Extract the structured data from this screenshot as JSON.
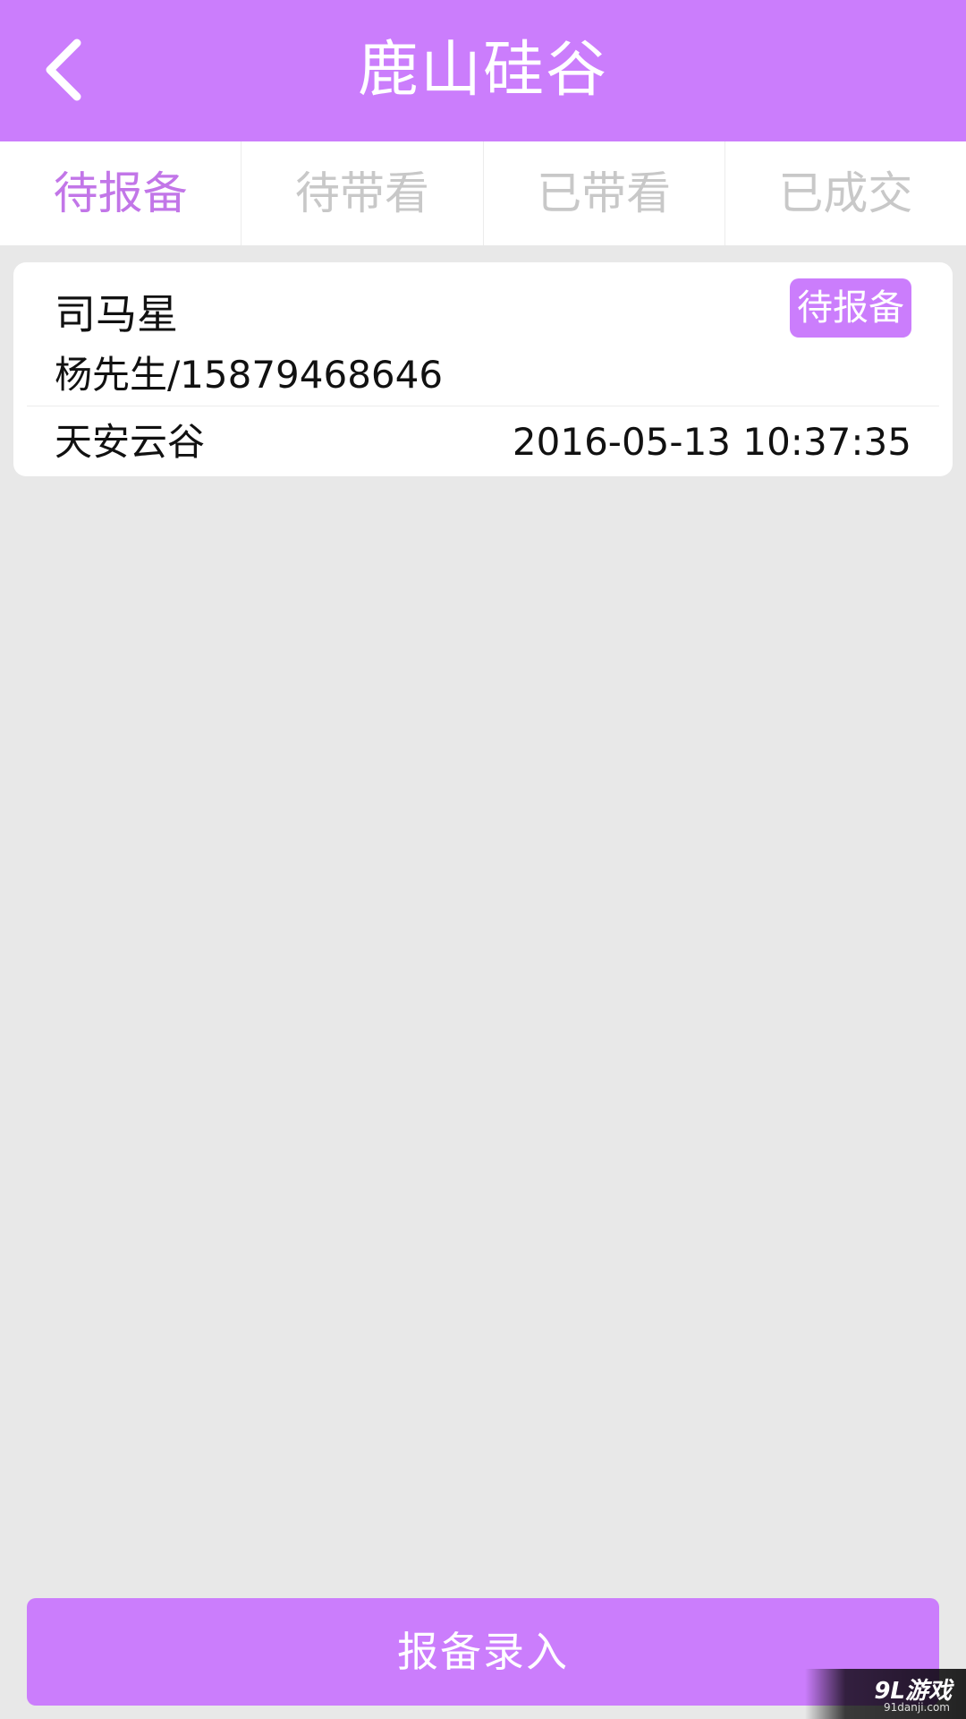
{
  "header": {
    "title": "鹿山硅谷",
    "back_icon": "chevron-left-icon"
  },
  "tabs": [
    {
      "label": "待报备",
      "active": true
    },
    {
      "label": "待带看",
      "active": false
    },
    {
      "label": "已带看",
      "active": false
    },
    {
      "label": "已成交",
      "active": false
    }
  ],
  "report_card": {
    "customer_name": "司马星",
    "status": "待报备",
    "contact": "杨先生/15879468646",
    "project": "天安云谷",
    "time": "2016-05-13 10:37:35"
  },
  "footer": {
    "submit_label": "报备录入"
  },
  "watermark": {
    "main": "9L游戏",
    "sub": "91danji.com"
  },
  "colors": {
    "brand": "#cb7dfc",
    "tab_active": "#c276e8",
    "tab_inactive": "#c8c8c8",
    "background": "#e8e8e8"
  }
}
